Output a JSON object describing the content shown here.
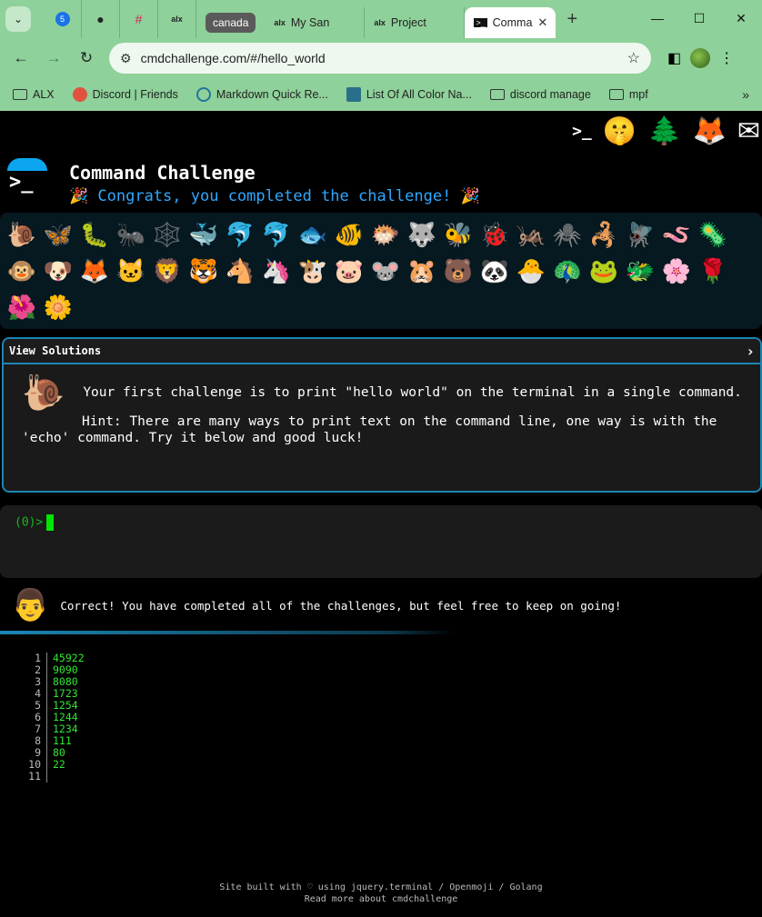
{
  "browser": {
    "tabs": [
      {
        "label": "",
        "favicon": "notification-badge-icon",
        "badge": "5"
      },
      {
        "label": "",
        "favicon": "github-icon"
      },
      {
        "label": "",
        "favicon": "slack-icon"
      },
      {
        "label": "",
        "favicon": "alx-icon",
        "fav_text": "alx"
      },
      {
        "label": "canada",
        "group": true
      },
      {
        "label": "My San",
        "favicon": "alx-icon",
        "fav_text": "alx"
      },
      {
        "label": "Project",
        "favicon": "alx-icon",
        "fav_text": "alx"
      },
      {
        "label": "Comma",
        "favicon": "terminal-icon",
        "active": true
      }
    ],
    "url": "cmdchallenge.com/#/hello_world",
    "bookmarks": [
      {
        "label": "ALX",
        "icon": "folder-icon"
      },
      {
        "label": "Discord | Friends",
        "icon": "discord-icon"
      },
      {
        "label": "Markdown Quick Re...",
        "icon": "wordpress-icon"
      },
      {
        "label": "List Of All Color Na...",
        "icon": "gn-icon"
      },
      {
        "label": "discord manage",
        "icon": "folder-icon"
      },
      {
        "label": "mpf",
        "icon": "folder-icon"
      }
    ]
  },
  "page": {
    "title": "Command Challenge",
    "congrats": "🎉 Congrats, you completed the challenge! 🎉",
    "animals": [
      "🐌",
      "🦋",
      "🐛",
      "🐜",
      "🕸️",
      "🐳",
      "🐬",
      "🐬",
      "🐟",
      "🐠",
      "🐡",
      "🐺",
      "🐝",
      "🐞",
      "🦗",
      "🕷️",
      "🦂",
      "🪰",
      "🪱",
      "🦠",
      "🐵",
      "🐶",
      "🦊",
      "🐱",
      "🦁",
      "🐯",
      "🐴",
      "🦄",
      "🐮",
      "🐷",
      "🐭",
      "🐹",
      "🐻",
      "🐼",
      "🐣",
      "🦚",
      "🐸",
      "🐲",
      "🌸",
      "🌹",
      "🌺",
      "🌼"
    ],
    "solutions_label": "View Solutions",
    "challenge_text": "Your first challenge is to print \"hello world\" on the terminal in a single command.",
    "hint_text": "Hint: There are many ways to print text on the command line, one way is with the 'echo' command. Try it below and good luck!",
    "prompt": "(0)>",
    "correct_text": "Correct! You have completed all of the challenges, but feel free to keep on going!",
    "output": [
      {
        "n": "1",
        "v": "45922"
      },
      {
        "n": "2",
        "v": "9090"
      },
      {
        "n": "3",
        "v": "8080"
      },
      {
        "n": "4",
        "v": "1723"
      },
      {
        "n": "5",
        "v": "1254"
      },
      {
        "n": "6",
        "v": "1244"
      },
      {
        "n": "7",
        "v": "1234"
      },
      {
        "n": "8",
        "v": "111"
      },
      {
        "n": "9",
        "v": "80"
      },
      {
        "n": "10",
        "v": "22"
      },
      {
        "n": "11",
        "v": ""
      }
    ],
    "footer_line1": "Site built with ♡ using jquery.terminal / Openmoji / Golang",
    "footer_line2": "Read more about cmdchallenge"
  }
}
